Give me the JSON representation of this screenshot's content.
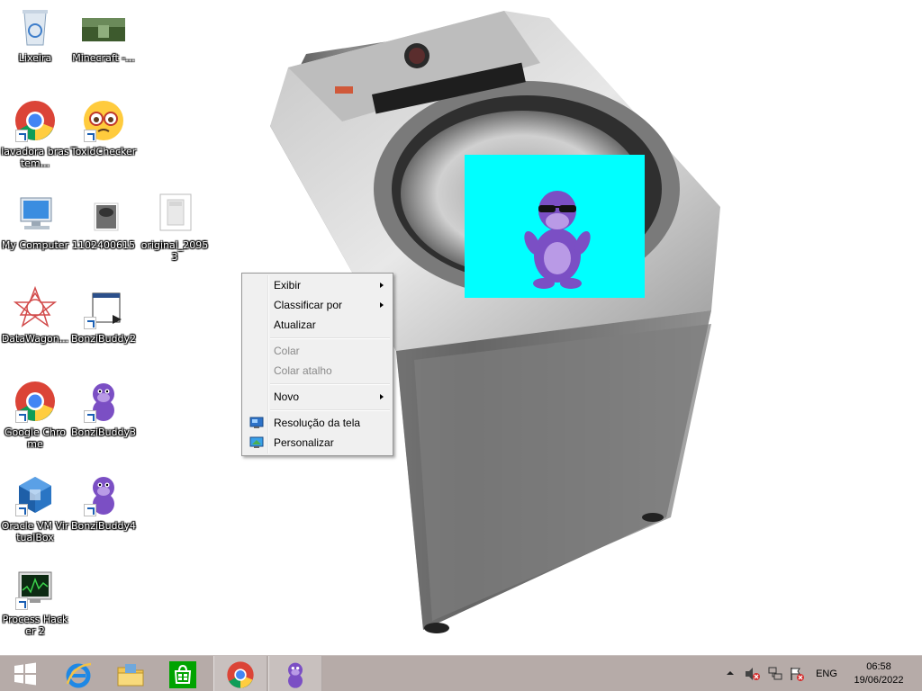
{
  "desktop": {
    "icons": [
      {
        "label": "Lixeira",
        "icon": "recycle-bin-icon"
      },
      {
        "label": "Minecraft -...",
        "icon": "minecraft-thumbnail-icon"
      },
      {
        "label": "lavadora brastem...",
        "icon": "chrome-icon"
      },
      {
        "label": "ToxidChecker",
        "icon": "emoji-face-icon"
      },
      {
        "label": "My Computer",
        "icon": "computer-icon"
      },
      {
        "label": "1102400615",
        "icon": "washer-thumbnail-icon"
      },
      {
        "label": "original_2095 3",
        "icon": "washer-white-thumbnail-icon"
      },
      {
        "label": "DataWagon...",
        "icon": "datawagon-icon"
      },
      {
        "label": "BonziBuddy2",
        "icon": "bonzi-setup-icon"
      },
      {
        "label": "Google Chrome",
        "icon": "chrome-icon"
      },
      {
        "label": "BonziBuddy3",
        "icon": "bonzi-icon"
      },
      {
        "label": "Oracle VM VirtualBox",
        "icon": "virtualbox-icon"
      },
      {
        "label": "BonziBuddy4",
        "icon": "bonzi-icon"
      },
      {
        "label": "Process Hacker 2",
        "icon": "process-hacker-icon"
      }
    ]
  },
  "context_menu": {
    "items": [
      {
        "label": "Exibir",
        "submenu": true,
        "enabled": true
      },
      {
        "label": "Classificar por",
        "submenu": true,
        "enabled": true
      },
      {
        "label": "Atualizar",
        "submenu": false,
        "enabled": true
      },
      {
        "label": "Colar",
        "submenu": false,
        "enabled": false
      },
      {
        "label": "Colar atalho",
        "submenu": false,
        "enabled": false
      },
      {
        "label": "Novo",
        "submenu": true,
        "enabled": true
      },
      {
        "label": "Resolução da tela",
        "submenu": false,
        "enabled": true,
        "icon": "display-settings-icon"
      },
      {
        "label": "Personalizar",
        "submenu": false,
        "enabled": true,
        "icon": "personalize-icon"
      }
    ]
  },
  "taskbar": {
    "apps": [
      {
        "name": "start",
        "icon": "windows-start-icon"
      },
      {
        "name": "internet-explorer",
        "icon": "internet-explorer-icon"
      },
      {
        "name": "file-explorer",
        "icon": "file-explorer-icon"
      },
      {
        "name": "store",
        "icon": "windows-store-icon"
      },
      {
        "name": "chrome",
        "icon": "chrome-icon",
        "active": true
      },
      {
        "name": "bonzibuddy",
        "icon": "bonzi-icon",
        "active": true
      }
    ],
    "tray": {
      "icons": [
        "show-hidden-icons-chevron",
        "volume-muted-icon",
        "network-icon",
        "action-center-flag-icon"
      ],
      "language": "ENG",
      "time": "06:58",
      "date": "19/06/2022"
    }
  },
  "colors": {
    "taskbar": "#b6aba8",
    "bonzi_window_bg": "#00ffff",
    "bonzi_purple": "#7b4fc4"
  }
}
